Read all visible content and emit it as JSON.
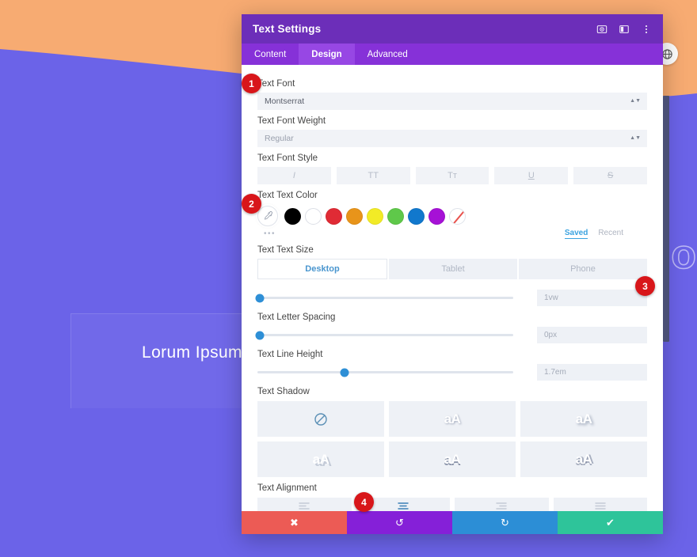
{
  "background": {
    "hero_color": "#f7ab72",
    "page_color": "#6b63e8",
    "outline_word": "no",
    "card_text": "Lorum Ipsum",
    "globe_icon": "globe-icon"
  },
  "modal": {
    "title": "Text Settings",
    "header_icons": [
      {
        "name": "target-icon",
        "label": "target"
      },
      {
        "name": "layout-panel-icon",
        "label": "layout"
      },
      {
        "name": "more-vertical-icon",
        "label": "more"
      }
    ],
    "tabs": [
      {
        "label": "Content",
        "active": false
      },
      {
        "label": "Design",
        "active": true
      },
      {
        "label": "Advanced",
        "active": false
      }
    ],
    "fields": {
      "font": {
        "label": "Text Font",
        "value": "Montserrat"
      },
      "font_weight": {
        "label": "Text Font Weight",
        "value": "Regular"
      },
      "font_style": {
        "label": "Text Font Style",
        "buttons": [
          {
            "name": "italic-button",
            "glyph": "I"
          },
          {
            "name": "uppercase-button",
            "glyph": "TT"
          },
          {
            "name": "smallcaps-button",
            "glyph": "Tт"
          },
          {
            "name": "underline-button",
            "glyph": "U"
          },
          {
            "name": "strikethrough-button",
            "glyph": "S"
          }
        ]
      },
      "text_color": {
        "label": "Text Text Color",
        "picker_icon": "eyedropper-icon",
        "more_dots": "•••",
        "swatches": [
          {
            "name": "swatch-black",
            "color": "#000000"
          },
          {
            "name": "swatch-white",
            "color": "#ffffff"
          },
          {
            "name": "swatch-red",
            "color": "#e02b35"
          },
          {
            "name": "swatch-orange",
            "color": "#e8941a"
          },
          {
            "name": "swatch-yellow",
            "color": "#f2eb26"
          },
          {
            "name": "swatch-green",
            "color": "#5fc84a"
          },
          {
            "name": "swatch-blue",
            "color": "#1178cd"
          },
          {
            "name": "swatch-purple",
            "color": "#a611d6"
          },
          {
            "name": "swatch-none",
            "color": "transparent"
          }
        ],
        "saved_label": "Saved",
        "recent_label": "Recent"
      },
      "text_size": {
        "label": "Text Text Size",
        "devices": [
          {
            "label": "Desktop",
            "active": true
          },
          {
            "label": "Tablet",
            "active": false
          },
          {
            "label": "Phone",
            "active": false
          }
        ],
        "value": "1vw",
        "knob_percent": 1
      },
      "letter_spacing": {
        "label": "Text Letter Spacing",
        "value": "0px",
        "knob_percent": 1
      },
      "line_height": {
        "label": "Text Line Height",
        "value": "1.7em",
        "knob_percent": 34
      },
      "text_shadow": {
        "label": "Text Shadow",
        "tiles": [
          {
            "name": "shadow-none-tile",
            "glyph": "",
            "icon": "prohibited-icon"
          },
          {
            "name": "shadow-preset-1-tile",
            "glyph": "aA",
            "icon": ""
          },
          {
            "name": "shadow-preset-2-tile",
            "glyph": "aA",
            "icon": ""
          },
          {
            "name": "shadow-preset-3-tile",
            "glyph": "aA",
            "icon": ""
          },
          {
            "name": "shadow-preset-4-tile",
            "glyph": "aA",
            "icon": ""
          },
          {
            "name": "shadow-preset-5-tile",
            "glyph": "aA",
            "icon": ""
          }
        ]
      },
      "text_alignment": {
        "label": "Text Alignment",
        "buttons": [
          {
            "name": "align-left-button",
            "active": false
          },
          {
            "name": "align-center-button",
            "active": true
          },
          {
            "name": "align-right-button",
            "active": false
          },
          {
            "name": "align-justify-button",
            "active": false
          }
        ]
      }
    },
    "footer": [
      {
        "name": "cancel-button",
        "icon": "close-icon",
        "glyph": "✖",
        "color": "#ec5b55"
      },
      {
        "name": "undo-button",
        "icon": "undo-icon",
        "glyph": "↺",
        "color": "#8520d8"
      },
      {
        "name": "redo-button",
        "icon": "redo-icon",
        "glyph": "↻",
        "color": "#2c8ed6"
      },
      {
        "name": "save-button",
        "icon": "check-icon",
        "glyph": "✔",
        "color": "#2ec49a"
      }
    ]
  },
  "badges": [
    {
      "label": "1"
    },
    {
      "label": "2"
    },
    {
      "label": "3"
    },
    {
      "label": "4"
    }
  ]
}
